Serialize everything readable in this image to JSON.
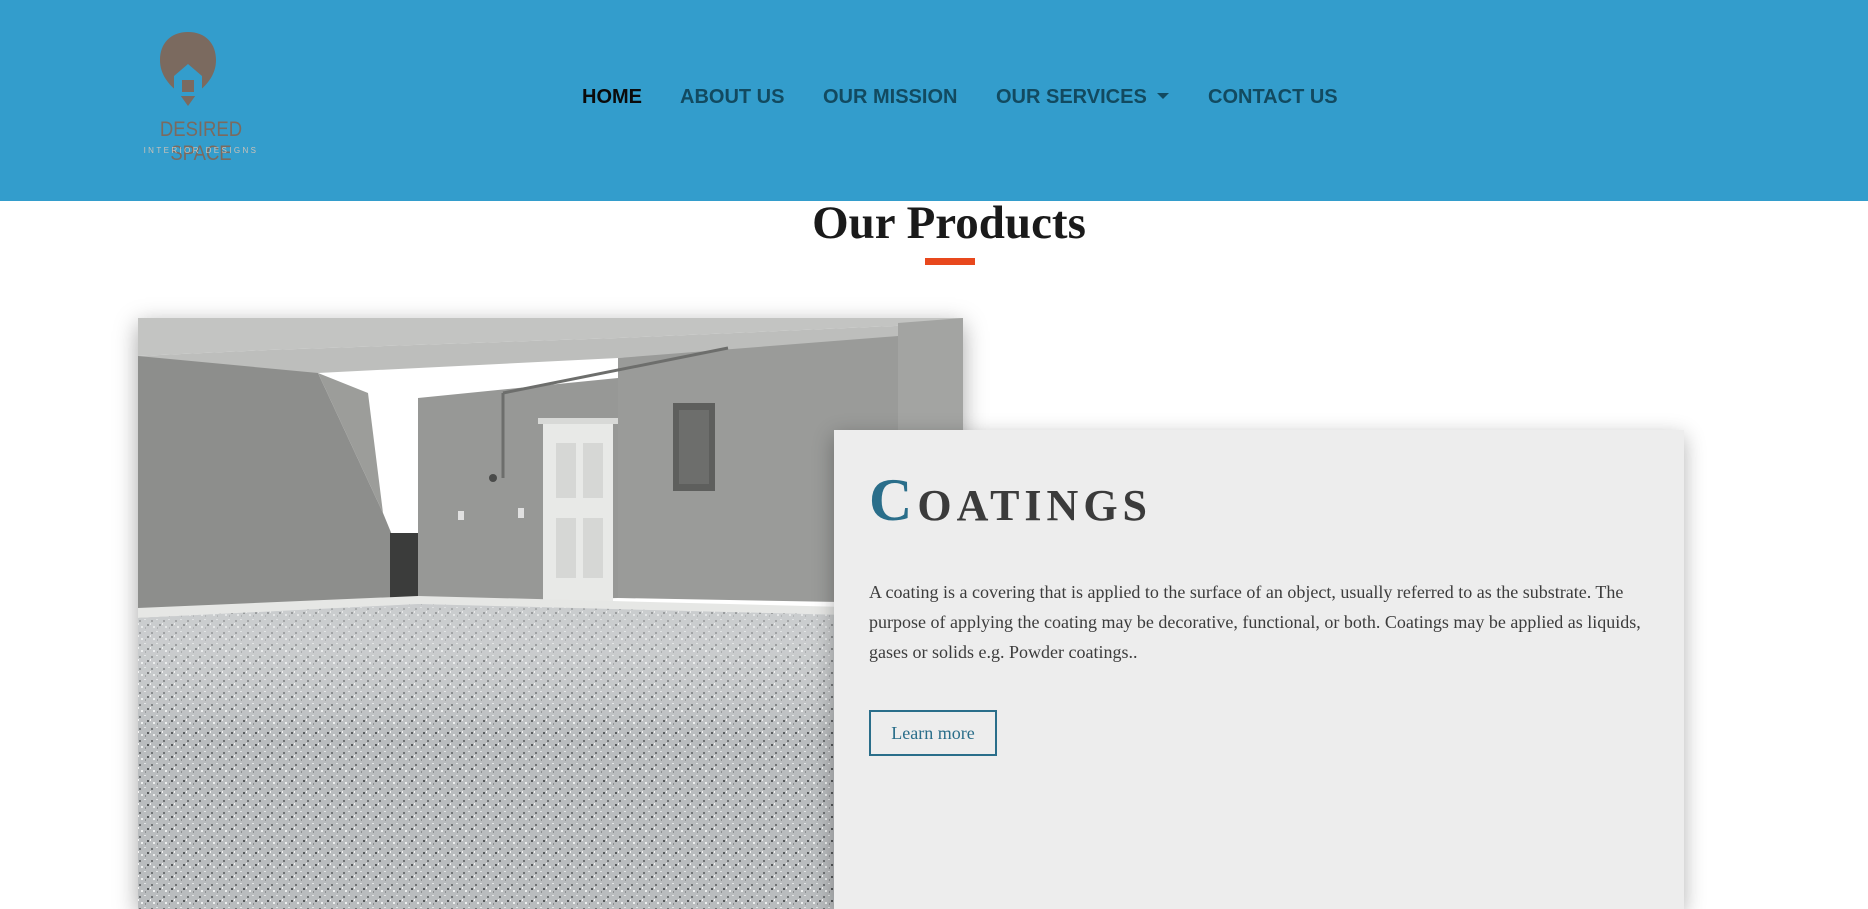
{
  "brand": {
    "name": "DESIRED SPACE",
    "tagline": "INTERIOR DESIGNS",
    "logo_icon": "house-icon",
    "header_color": "#339dcc"
  },
  "nav": {
    "items": [
      {
        "label": "HOME",
        "active": true
      },
      {
        "label": "ABOUT US"
      },
      {
        "label": "OUR MISSION"
      },
      {
        "label": "OUR SERVICES",
        "dropdown": true
      },
      {
        "label": "CONTACT US"
      }
    ]
  },
  "products": {
    "title": "Our Products",
    "accent_color": "#e8481d",
    "card": {
      "title_first_letter": "C",
      "title_rest": "OATINGS",
      "body": "A coating is a covering that is applied to the surface of an object, usually referred to as the substrate. The purpose of applying the coating may be decorative, functional, or both. Coatings may be applied as liquids, gases or solids e.g. Powder coatings..",
      "button_label": "Learn more"
    },
    "image_icon": "garage-floor-photo"
  }
}
